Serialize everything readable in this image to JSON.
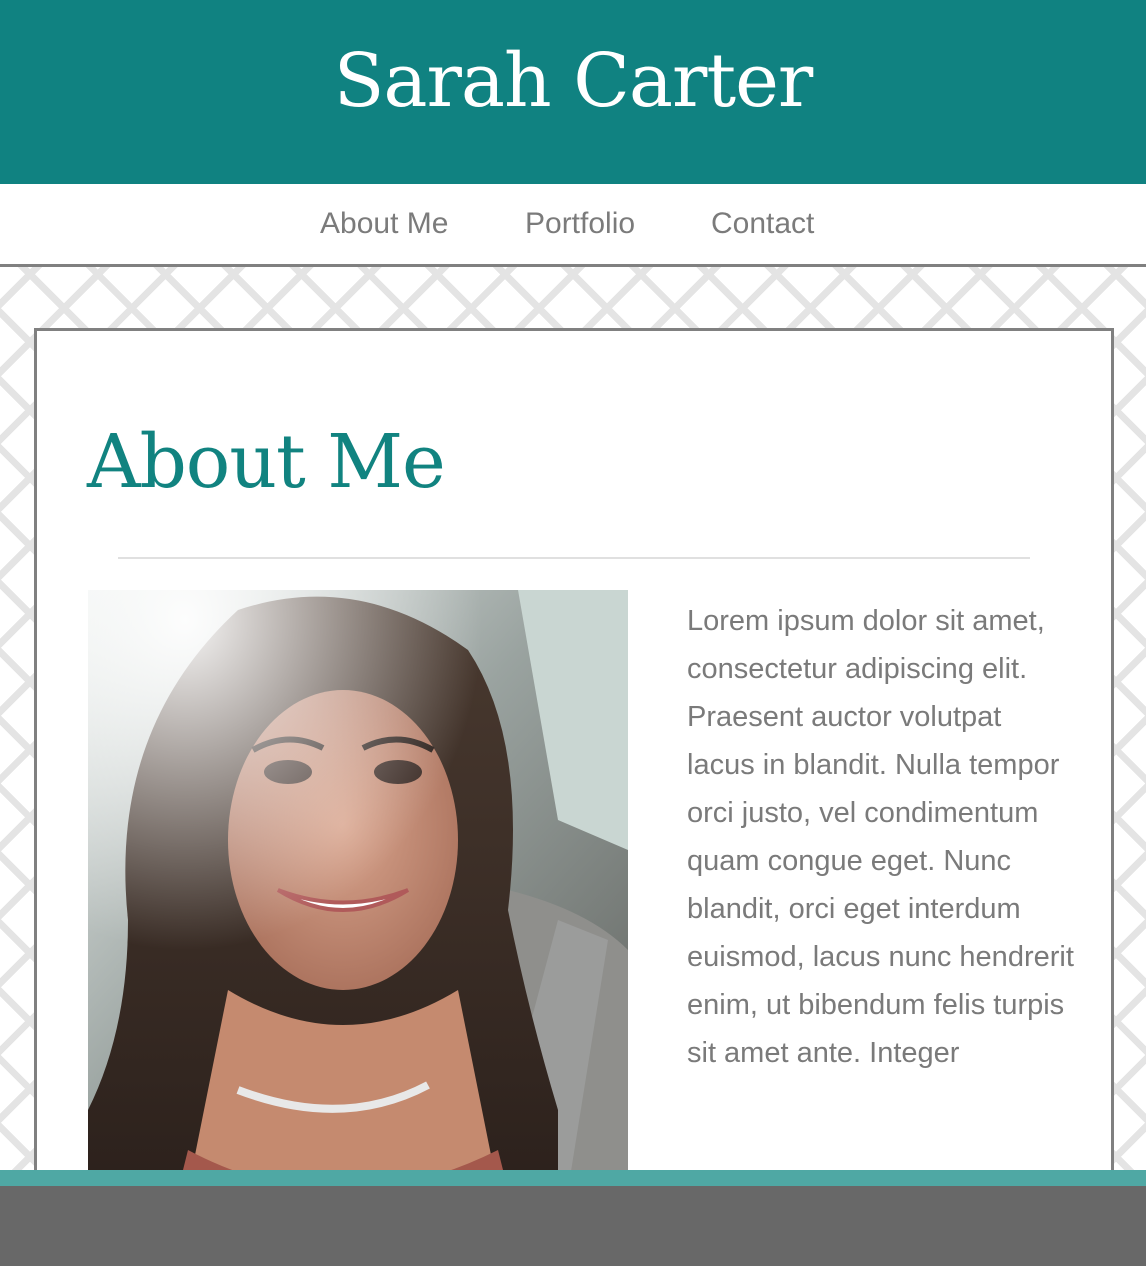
{
  "header": {
    "title": "Sarah Carter",
    "background": "#108281"
  },
  "nav": {
    "items": [
      {
        "label": "About Me"
      },
      {
        "label": "Portfolio"
      },
      {
        "label": "Contact"
      }
    ]
  },
  "main": {
    "heading": "About Me",
    "bio": "Lorem ipsum dolor sit amet, consectetur adipiscing elit. Praesent auctor volutpat lacus in blandit. Nulla tempor orci justo, vel condimentum quam congue eget. Nunc blandit, orci eget interdum euismod, lacus nunc hendrerit enim, ut bibendum felis turpis sit amet ante. Integer"
  },
  "colors": {
    "accent": "#108281",
    "heading": "#118380",
    "footer": "#686868",
    "footer_accent": "#4fa8a4",
    "text": "#7a7a7a"
  }
}
